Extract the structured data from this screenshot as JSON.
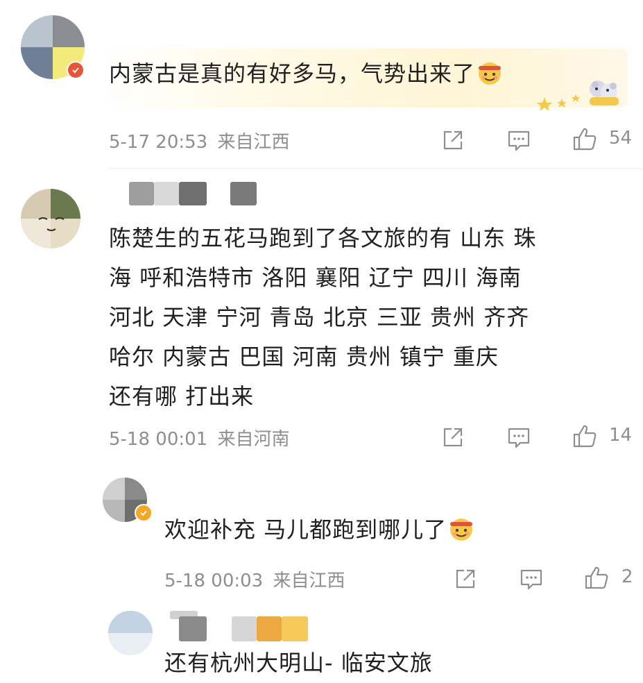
{
  "colors": {
    "text": "#1f1f1f",
    "meta": "#8e8e8e",
    "divider": "#ececec",
    "verified_badge": "#f5a623",
    "bubble_bg": "#fff7dc"
  },
  "comments": [
    {
      "text": "内蒙古是真的有好多马，气势出来了",
      "emoji": "smile-headband-emoji",
      "timestamp": "5-17 20:53",
      "location": "来自江西",
      "likes": "54"
    },
    {
      "lines": [
        "陈楚生的五花马跑到了各文旅的有  山东  珠",
        "海  呼和浩特市   洛阳  襄阳  辽宁  四川  海南",
        "河北  天津  宁河  青岛  北京 三亚  贵州   齐齐",
        "哈尔   内蒙古   巴国  河南   贵州 镇宁  重庆",
        "还有哪 打出来"
      ],
      "timestamp": "5-18 00:01",
      "location": "来自河南",
      "likes": "14"
    },
    {
      "text": "欢迎补充 马儿都跑到哪儿了",
      "emoji": "smile-headband-emoji",
      "timestamp": "5-18 00:03",
      "location": "来自江西",
      "likes": "2"
    },
    {
      "text": "还有杭州大明山- 临安文旅"
    }
  ]
}
